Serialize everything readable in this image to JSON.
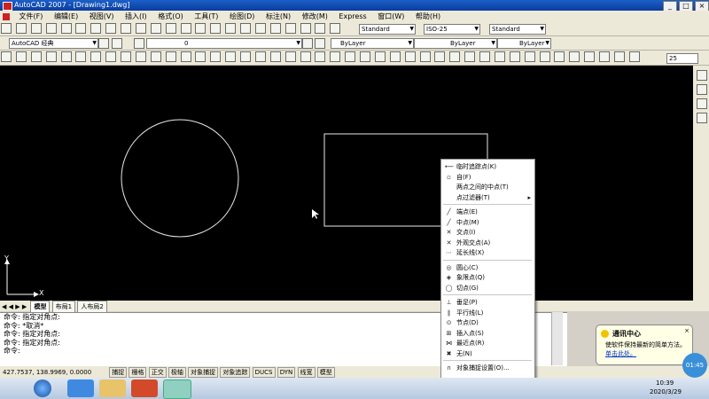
{
  "window": {
    "title": "AutoCAD 2007 - [Drawing1.dwg]",
    "min": "_",
    "max": "□",
    "close": "×"
  },
  "menu": [
    "文件(F)",
    "编辑(E)",
    "视图(V)",
    "插入(I)",
    "格式(O)",
    "工具(T)",
    "绘图(D)",
    "标注(N)",
    "修改(M)",
    "Express",
    "窗口(W)",
    "帮助(H)"
  ],
  "toolbars": {
    "text_style": "Standard",
    "dim_style": "ISO-25",
    "table_style": "Standard",
    "workspace": "AutoCAD 经典",
    "layer": "0",
    "color": "ByLayer",
    "linetype": "ByLayer",
    "lineweight": "ByLayer",
    "dim_scale": "25"
  },
  "axis": {
    "y": "Y",
    "x": "X"
  },
  "tabs": {
    "model": "模型",
    "layout1": "布局1",
    "layout2": "人布局2"
  },
  "command": {
    "lines": [
      "命令: 指定对角点:",
      "命令: *取消*",
      "命令: 指定对角点:",
      "命令: 指定对角点:",
      "命令:"
    ]
  },
  "status": {
    "coords": "427.7537, 138.9969, 0.0000",
    "buttons": [
      "捕捉",
      "栅格",
      "正交",
      "极轴",
      "对象捕捉",
      "对象追踪",
      "DUCS",
      "DYN",
      "线宽",
      "模型"
    ]
  },
  "context_menu": {
    "items": [
      {
        "icon": "temp-track",
        "label": "临时追踪点(K)"
      },
      {
        "icon": "from",
        "label": "自(F)"
      },
      {
        "icon": "",
        "label": "两点之间的中点(T)"
      },
      {
        "icon": "",
        "label": "点过滤器(T)",
        "submenu": true
      },
      {
        "icon": "endpoint",
        "label": "端点(E)"
      },
      {
        "icon": "midpoint",
        "label": "中点(M)"
      },
      {
        "icon": "intersection",
        "label": "交点(I)"
      },
      {
        "icon": "apparent-intersection",
        "label": "外观交点(A)"
      },
      {
        "icon": "extension",
        "label": "延长线(X)"
      },
      {
        "icon": "center",
        "label": "圆心(C)"
      },
      {
        "icon": "quadrant",
        "label": "象限点(Q)"
      },
      {
        "icon": "tangent",
        "label": "切点(G)"
      },
      {
        "icon": "perpendicular",
        "label": "垂足(P)"
      },
      {
        "icon": "parallel",
        "label": "平行线(L)"
      },
      {
        "icon": "node",
        "label": "节点(D)"
      },
      {
        "icon": "insert",
        "label": "插入点(S)"
      },
      {
        "icon": "nearest",
        "label": "最近点(R)"
      },
      {
        "icon": "none",
        "label": "无(N)"
      },
      {
        "icon": "osnap-settings",
        "label": "对象捕捉设置(O)..."
      }
    ]
  },
  "notification": {
    "title": "通讯中心",
    "body": "使软件保持最新的简单方法。",
    "link": "单击此处。"
  },
  "clock": {
    "time": "10:39",
    "date": "2020/3/29",
    "bubble": "01:45"
  }
}
